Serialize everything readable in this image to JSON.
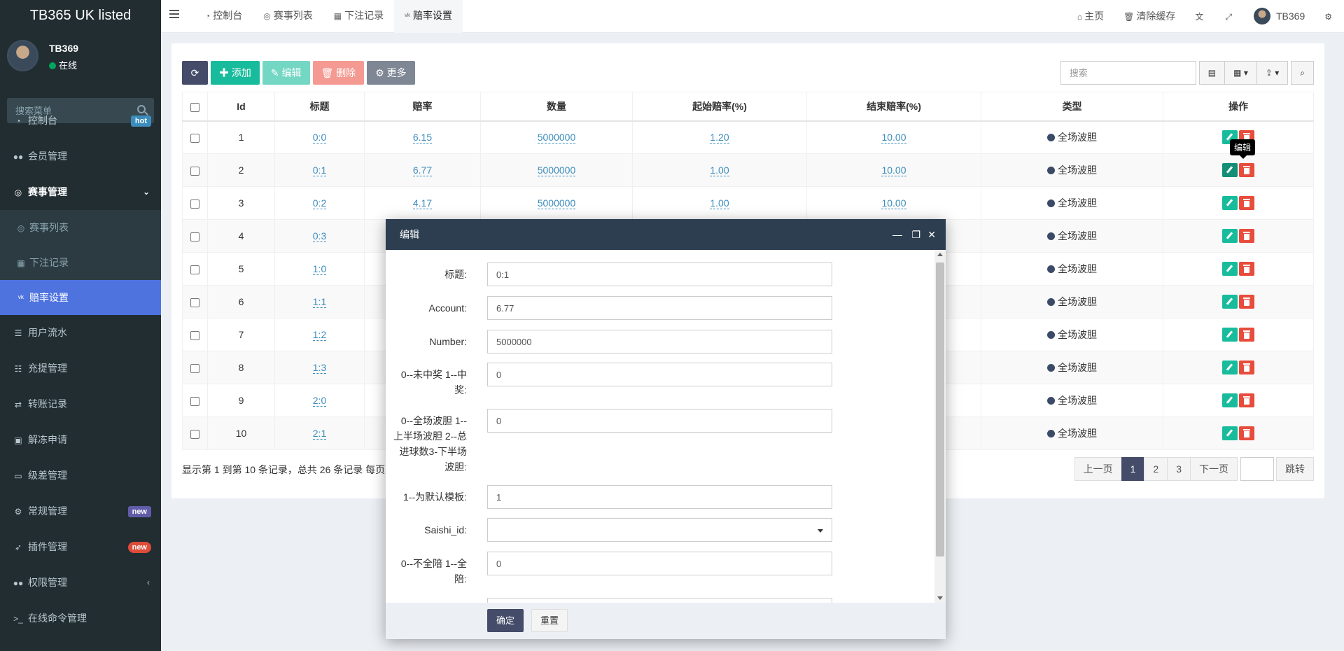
{
  "brand": "TB365 UK listed",
  "user": {
    "name": "TB369",
    "status": "在线"
  },
  "sidebar": {
    "search_placeholder": "搜索菜单",
    "items": [
      {
        "label": "控制台",
        "icon": "dashboard-icon",
        "badge": "hot"
      },
      {
        "label": "会员管理",
        "icon": "users-icon"
      },
      {
        "label": "赛事管理",
        "icon": "lifebuoy-icon"
      },
      {
        "label": "用户流水",
        "icon": "list-icon"
      },
      {
        "label": "充提管理",
        "icon": "list-alt-icon"
      },
      {
        "label": "转账记录",
        "icon": "exchange-icon"
      },
      {
        "label": "解冻申请",
        "icon": "image-icon"
      },
      {
        "label": "级差管理",
        "icon": "window-icon"
      },
      {
        "label": "常规管理",
        "icon": "cogs-icon",
        "badge": "new"
      },
      {
        "label": "插件管理",
        "icon": "rocket-icon",
        "badge": "new"
      },
      {
        "label": "权限管理",
        "icon": "group-icon"
      },
      {
        "label": "在线命令管理",
        "icon": "terminal-icon"
      }
    ],
    "subitems": [
      {
        "label": "赛事列表",
        "icon": "lifebuoy-icon"
      },
      {
        "label": "下注记录",
        "icon": "calendar-icon"
      },
      {
        "label": "赔率设置",
        "icon": "vk-icon"
      }
    ]
  },
  "header": {
    "tabs": [
      {
        "label": "控制台"
      },
      {
        "label": "赛事列表"
      },
      {
        "label": "下注记录"
      },
      {
        "label": "赔率设置"
      }
    ],
    "home": "主页",
    "clear_cache": "清除缓存",
    "username": "TB369"
  },
  "toolbar": {
    "add": "添加",
    "edit": "编辑",
    "delete": "删除",
    "more": "更多",
    "search_placeholder": "搜索"
  },
  "table": {
    "columns": [
      "Id",
      "标题",
      "赔率",
      "数量",
      "起始赔率(%)",
      "结束赔率(%)",
      "类型",
      "操作"
    ],
    "rows": [
      {
        "id": "1",
        "title": "0:0",
        "odds": "6.15",
        "qty": "5000000",
        "start": "1.20",
        "end": "10.00",
        "type": "全场波胆"
      },
      {
        "id": "2",
        "title": "0:1",
        "odds": "6.77",
        "qty": "5000000",
        "start": "1.00",
        "end": "10.00",
        "type": "全场波胆"
      },
      {
        "id": "3",
        "title": "0:2",
        "odds": "4.17",
        "qty": "5000000",
        "start": "1.00",
        "end": "10.00",
        "type": "全场波胆"
      },
      {
        "id": "4",
        "title": "0:3",
        "odds": "",
        "qty": "",
        "start": "",
        "end": "",
        "type": "全场波胆"
      },
      {
        "id": "5",
        "title": "1:0",
        "odds": "",
        "qty": "",
        "start": "",
        "end": "",
        "type": "全场波胆"
      },
      {
        "id": "6",
        "title": "1:1",
        "odds": "",
        "qty": "",
        "start": "",
        "end": "",
        "type": "全场波胆"
      },
      {
        "id": "7",
        "title": "1:2",
        "odds": "",
        "qty": "",
        "start": "",
        "end": "",
        "type": "全场波胆"
      },
      {
        "id": "8",
        "title": "1:3",
        "odds": "",
        "qty": "",
        "start": "",
        "end": "",
        "type": "全场波胆"
      },
      {
        "id": "9",
        "title": "2:0",
        "odds": "",
        "qty": "",
        "start": "",
        "end": "",
        "type": "全场波胆"
      },
      {
        "id": "10",
        "title": "2:1",
        "odds": "",
        "qty": "",
        "start": "",
        "end": "",
        "type": "全场波胆"
      }
    ],
    "tooltip": "编辑"
  },
  "pagination": {
    "info": "显示第 1 到第 10 条记录，总共 26 条记录 每页",
    "prev": "上一页",
    "pages": [
      "1",
      "2",
      "3"
    ],
    "next": "下一页",
    "jump": "跳转"
  },
  "modal": {
    "title": "编辑",
    "fields": [
      {
        "label": "标题:",
        "value": "0:1"
      },
      {
        "label": "Account:",
        "value": "6.77"
      },
      {
        "label": "Number:",
        "value": "5000000"
      },
      {
        "label": "0--未中奖 1--中奖:",
        "value": "0"
      },
      {
        "label": "0--全场波胆 1--上半场波胆 2--总进球数3-下半场波胆:",
        "value": "0"
      },
      {
        "label": "1--为默认模板:",
        "value": "1"
      },
      {
        "label": "Saishi_id:",
        "value": ""
      },
      {
        "label": "0--不全陪 1--全陪:",
        "value": "0"
      }
    ],
    "confirm": "确定",
    "reset": "重置"
  }
}
